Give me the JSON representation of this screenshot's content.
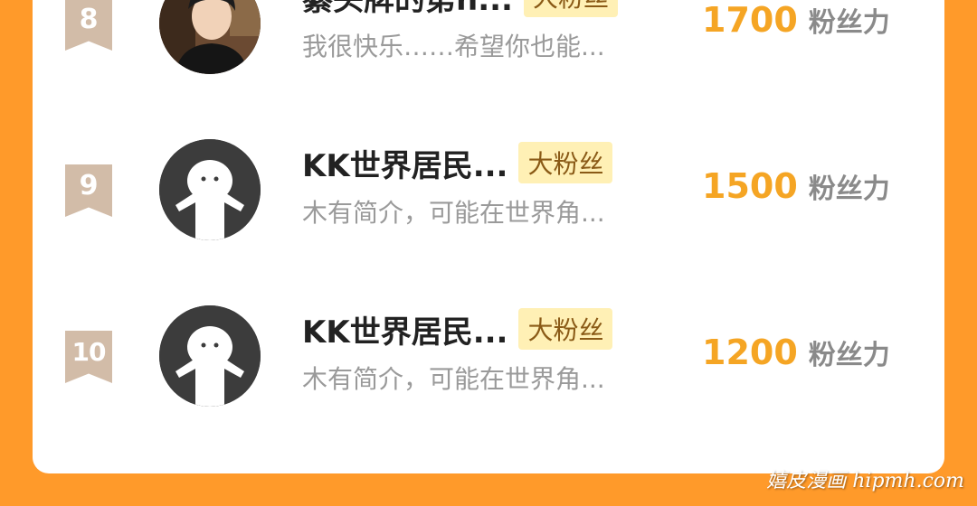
{
  "ranking": [
    {
      "rank": "8",
      "name": "綦头牌的第h...",
      "badge": "大粉丝",
      "bio": "我很快乐……希望你也能...",
      "score": "1700",
      "score_unit": "粉丝力",
      "avatar": "illustrated-man-avatar"
    },
    {
      "rank": "9",
      "name": "KK世界居民...",
      "badge": "大粉丝",
      "bio": "木有简介，可能在世界角...",
      "score": "1500",
      "score_unit": "粉丝力",
      "avatar": "default-avatar"
    },
    {
      "rank": "10",
      "name": "KK世界居民...",
      "badge": "大粉丝",
      "bio": "木有简介，可能在世界角...",
      "score": "1200",
      "score_unit": "粉丝力",
      "avatar": "default-avatar"
    }
  ],
  "watermark": "嬉皮漫画 hipmh.com",
  "colors": {
    "background": "#ff9a2a",
    "card": "#ffffff",
    "score": "#f5a524",
    "badge_bg": "#fff0b5",
    "rank_ribbon": "#d2bca8"
  }
}
